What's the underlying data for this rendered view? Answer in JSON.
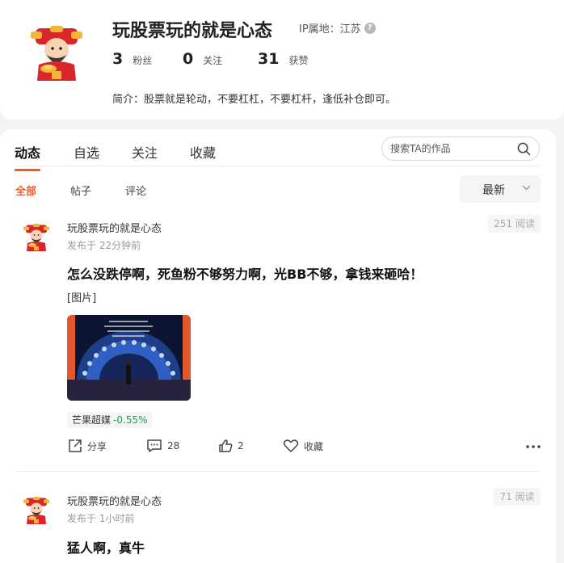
{
  "profile": {
    "name": "玩股票玩的就是心态",
    "ip_label": "IP属地：江苏",
    "help_icon": "question-circle-icon",
    "stats": [
      {
        "num": "3",
        "label": "粉丝"
      },
      {
        "num": "0",
        "label": "关注"
      },
      {
        "num": "31",
        "label": "获赞"
      }
    ],
    "bio": "简介：股票就是轮动，不要杠杠，不要杠杆，逢低补仓即可。"
  },
  "tabs": [
    "动态",
    "自选",
    "关注",
    "收藏"
  ],
  "search": {
    "placeholder": "搜索TA的作品",
    "icon": "search-icon"
  },
  "subtabs": [
    "全部",
    "帖子",
    "评论"
  ],
  "sort": {
    "label": "最新",
    "icon": "chevron-down-icon"
  },
  "posts": [
    {
      "author": "玩股票玩的就是心态",
      "time": "发布于 22分钟前",
      "reads": "251 阅读",
      "title": "怎么没跌停啊，死鱼粉不够努力啊，光BB不够，拿钱来砸哈！",
      "pic_label": "[图片]",
      "stock_name": "芒果超媒",
      "stock_change": "-0.55%",
      "actions": {
        "share": "分享",
        "comments": "28",
        "likes": "2",
        "favorite": "收藏"
      }
    },
    {
      "author": "玩股票玩的就是心态",
      "time": "发布于 1小时前",
      "reads": "71 阅读",
      "title": "猛人啊，真牛"
    }
  ],
  "colors": {
    "accent": "#f05a24",
    "down": "#1aa34a",
    "muted": "#999999"
  }
}
